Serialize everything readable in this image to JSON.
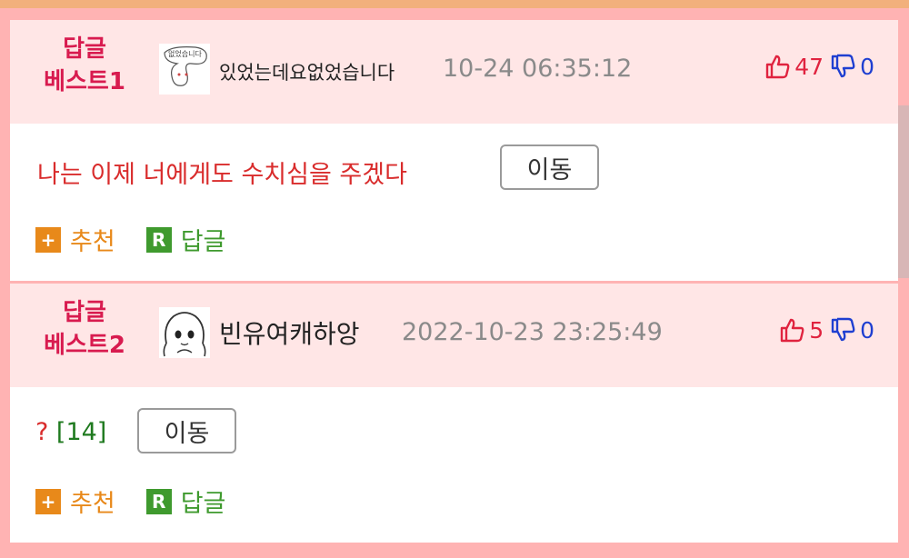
{
  "comments": [
    {
      "best_label_line1": "답글",
      "best_label_line2": "베스트1",
      "avatar_text": "없었습니다",
      "nickname": "있었는데요없었습니다",
      "timestamp": "10-24 06:35:12",
      "upvotes": "47",
      "downvotes": "0",
      "text": "나는 이제 너에게도 수치심을 주겠다",
      "move_label": "이동",
      "recommend_label": "추천",
      "reply_label": "답글",
      "plus_badge": "+",
      "r_badge": "R"
    },
    {
      "best_label_line1": "답글",
      "best_label_line2": "베스트2",
      "nickname": "빈유여캐하앙",
      "timestamp": "2022-10-23 23:25:49",
      "upvotes": "5",
      "downvotes": "0",
      "text_prefix": "? ",
      "text_count": "[14]",
      "move_label": "이동",
      "recommend_label": "추천",
      "reply_label": "답글",
      "plus_badge": "+",
      "r_badge": "R"
    }
  ],
  "colors": {
    "best_label": "#d81b4f",
    "comment_text": "#d92c2c",
    "upvote": "#e0233f",
    "downvote": "#1f3fd1",
    "recommend": "#e8891a",
    "reply": "#3f9a2e",
    "header_bg": "#ffe6e6",
    "frame_bg": "#ffb3b3"
  },
  "icons": [
    "thumbs-up-icon",
    "thumbs-down-icon",
    "plus-icon",
    "reply-icon"
  ]
}
